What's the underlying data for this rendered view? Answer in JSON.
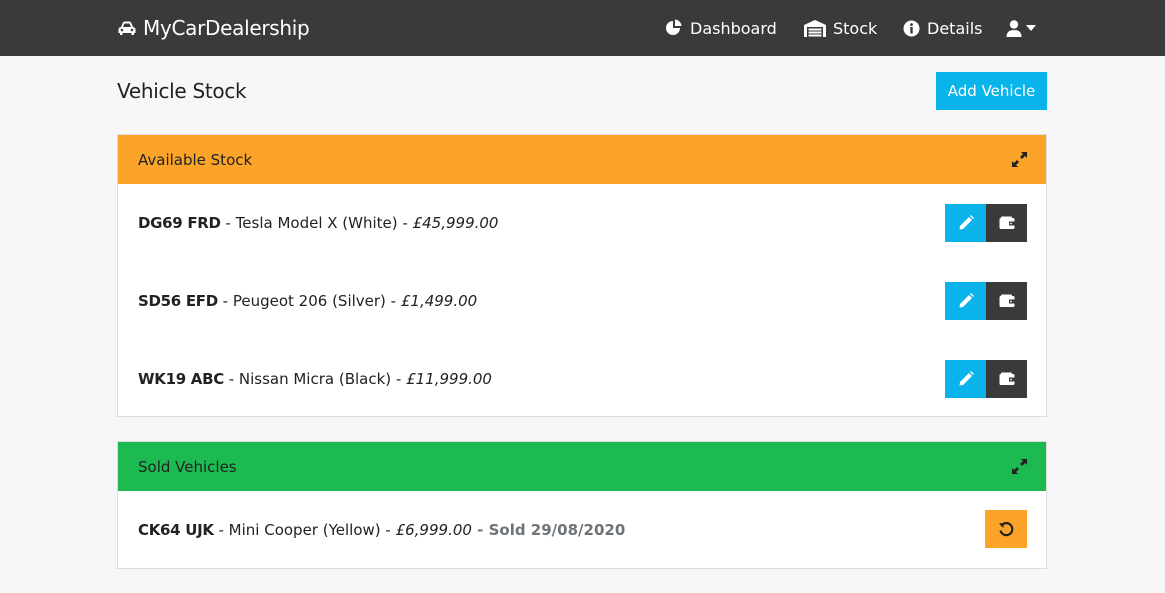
{
  "navbar": {
    "brand": "MyCarDealership",
    "items": [
      {
        "label": "Dashboard",
        "icon": "pie-chart-icon"
      },
      {
        "label": "Stock",
        "icon": "garage-icon"
      },
      {
        "label": "Details",
        "icon": "info-circle-icon"
      }
    ],
    "user_icon": "user-icon"
  },
  "page": {
    "title": "Vehicle Stock",
    "add_button": "Add Vehicle"
  },
  "available": {
    "title": "Available Stock",
    "vehicles": [
      {
        "reg": "DG69 FRD",
        "desc": " - Tesla Model X (White) - ",
        "price": "£45,999.00"
      },
      {
        "reg": "SD56 EFD",
        "desc": " - Peugeot 206 (Silver) - ",
        "price": "£1,499.00"
      },
      {
        "reg": "WK19 ABC",
        "desc": " - Nissan Micra (Black) - ",
        "price": "£11,999.00"
      }
    ]
  },
  "sold": {
    "title": "Sold Vehicles",
    "vehicles": [
      {
        "reg": "CK64 UJK",
        "desc": " - Mini Cooper (Yellow) - ",
        "price": "£6,999.00",
        "sep": " - ",
        "sold": "Sold 29/08/2020"
      }
    ]
  },
  "colors": {
    "navbar": "#3a3a3a",
    "accent_blue": "#0ab3ea",
    "stock_orange": "#fca42a",
    "sold_green": "#1dba52"
  }
}
